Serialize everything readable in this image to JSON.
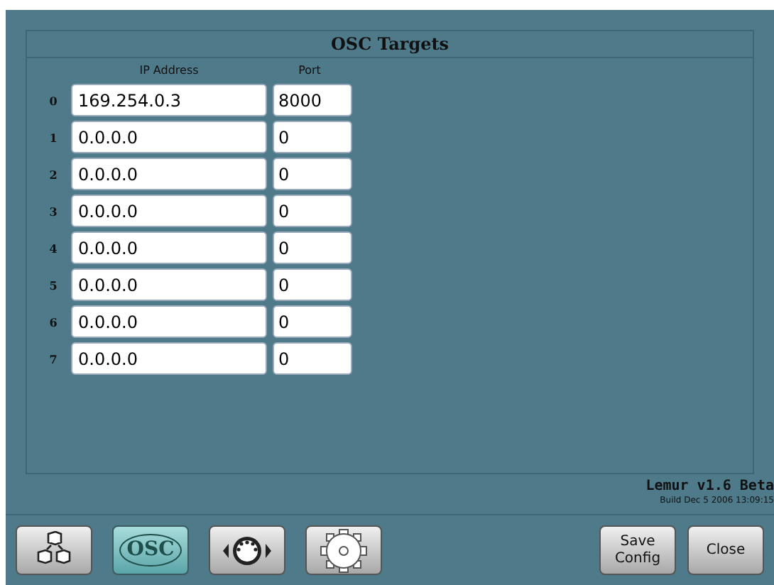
{
  "panel": {
    "title": "OSC Targets",
    "columns": [
      "IP Address",
      "Port"
    ],
    "rows": [
      {
        "index": "0",
        "ip": "169.254.0.3",
        "port": "8000"
      },
      {
        "index": "1",
        "ip": "0.0.0.0",
        "port": "0"
      },
      {
        "index": "2",
        "ip": "0.0.0.0",
        "port": "0"
      },
      {
        "index": "3",
        "ip": "0.0.0.0",
        "port": "0"
      },
      {
        "index": "4",
        "ip": "0.0.0.0",
        "port": "0"
      },
      {
        "index": "5",
        "ip": "0.0.0.0",
        "port": "0"
      },
      {
        "index": "6",
        "ip": "0.0.0.0",
        "port": "0"
      },
      {
        "index": "7",
        "ip": "0.0.0.0",
        "port": "0"
      }
    ]
  },
  "version": {
    "name": "Lemur v1.6 Beta",
    "build": "Build Dec  5 2006 13:09:15"
  },
  "tabs": [
    {
      "kind": "objects",
      "selected": false
    },
    {
      "kind": "osc",
      "label": "OSC",
      "selected": true
    },
    {
      "kind": "midi",
      "selected": false
    },
    {
      "kind": "settings",
      "selected": false
    }
  ],
  "buttons": [
    {
      "label": "Save\nConfig"
    },
    {
      "label": "Close"
    }
  ]
}
